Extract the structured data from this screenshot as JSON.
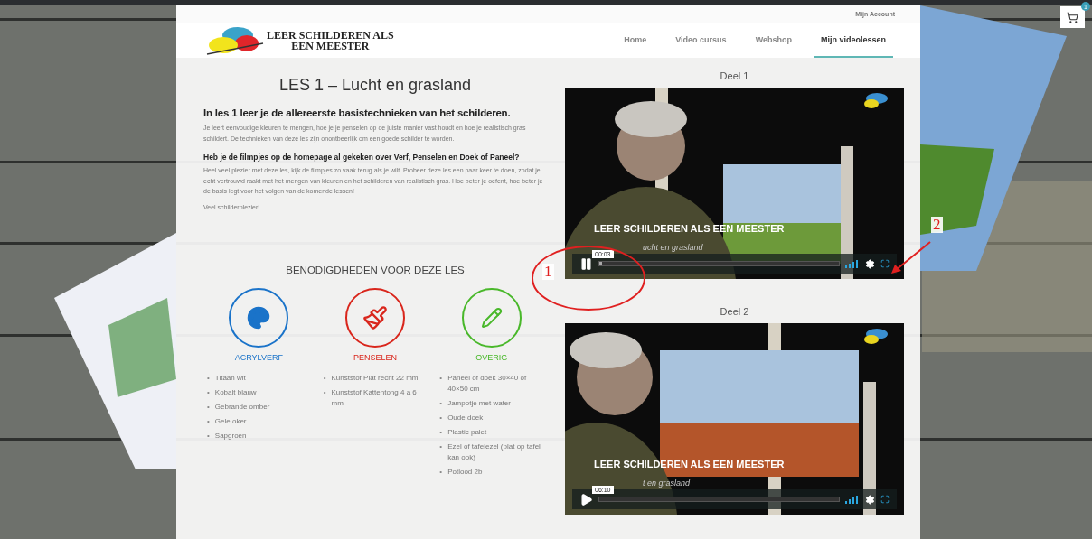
{
  "account_link": "Mijn Account",
  "logo": {
    "line1": "LEER SCHILDEREN ALS",
    "line2": "EEN MEESTER"
  },
  "nav": [
    {
      "label": "Home",
      "selected": false
    },
    {
      "label": "Video cursus",
      "selected": false
    },
    {
      "label": "Webshop",
      "selected": false
    },
    {
      "label": "Mijn videolessen",
      "selected": true
    }
  ],
  "cart": {
    "badge": "1"
  },
  "lesson": {
    "title": "LES 1 – Lucht en grasland",
    "intro_heading": "In les 1 leer je de allereerste basistechnieken van het schilderen.",
    "intro_text": "Je leert eenvoudige kleuren te mengen, hoe je je penselen op de juiste manier vast houdt en hoe je realistisch gras schildert. De technieken van deze les zijn onontbeerlijk om een goede schilder te worden.",
    "question_heading": "Heb je de filmpjes op de homepage al gekeken over Verf, Penselen en Doek of Paneel?",
    "question_text": "Heel veel plezier met deze les, kijk de filmpjes zo vaak terug als je wilt. Probeer deze les een paar keer te doen, zodat je echt vertrouwd raakt met het mengen van kleuren en het schilderen van realistisch gras. Hoe beter je oefent, hoe beter je de basis legt voor het volgen van de komende lessen!",
    "closing": "Veel schilderplezier!"
  },
  "supplies": {
    "title": "BENODIGDHEDEN VOOR DEZE LES",
    "categories": [
      {
        "kind": "palette",
        "label": "ACRYLVERF",
        "color": "#1a73c9",
        "items": [
          {
            "bullet": "•",
            "text": "Titaan wit"
          },
          {
            "bullet": "•",
            "text": "Kobalt blauw"
          },
          {
            "bullet": "•",
            "text": "Gebrande omber"
          },
          {
            "bullet": "•",
            "text": "Gele oker"
          },
          {
            "bullet": "•",
            "text": "Sapgroen"
          }
        ]
      },
      {
        "kind": "brush",
        "label": "PENSELEN",
        "color": "#d9261c",
        "items": [
          {
            "bullet": "•",
            "text": "Kunststof Plat recht 22 mm"
          },
          {
            "bullet": "•",
            "text": "Kunststof Kattentong 4 a 6 mm"
          }
        ]
      },
      {
        "kind": "pencil",
        "label": "OVERIG",
        "color": "#49b82a",
        "items": [
          {
            "bullet": "•",
            "text": "Paneel of doek 30×40 of 40×50 cm"
          },
          {
            "bullet": "•",
            "text": "Jampotje met water"
          },
          {
            "bullet": "•",
            "text": "Oude doek"
          },
          {
            "bullet": "•",
            "text": "Plastic palet"
          },
          {
            "bullet": "•",
            "text": "Ezel of tafelezel (plat op tafel kan ook)"
          },
          {
            "bullet": "•",
            "text": "Potlood 2b"
          }
        ]
      }
    ]
  },
  "videos": [
    {
      "heading": "Deel 1",
      "title": "LEER SCHILDEREN ALS EEN MEESTER",
      "subtitle": "ucht en grasland",
      "time": "00:03",
      "playing": true,
      "level": 0.01
    },
    {
      "heading": "Deel 2",
      "title": "LEER SCHILDEREN ALS EEN MEESTER",
      "subtitle": "t en grasland",
      "time": "06:10",
      "playing": false
    }
  ],
  "annotations": [
    {
      "kind": "ellipse",
      "label": "1"
    },
    {
      "kind": "arrow",
      "label": "2"
    }
  ]
}
